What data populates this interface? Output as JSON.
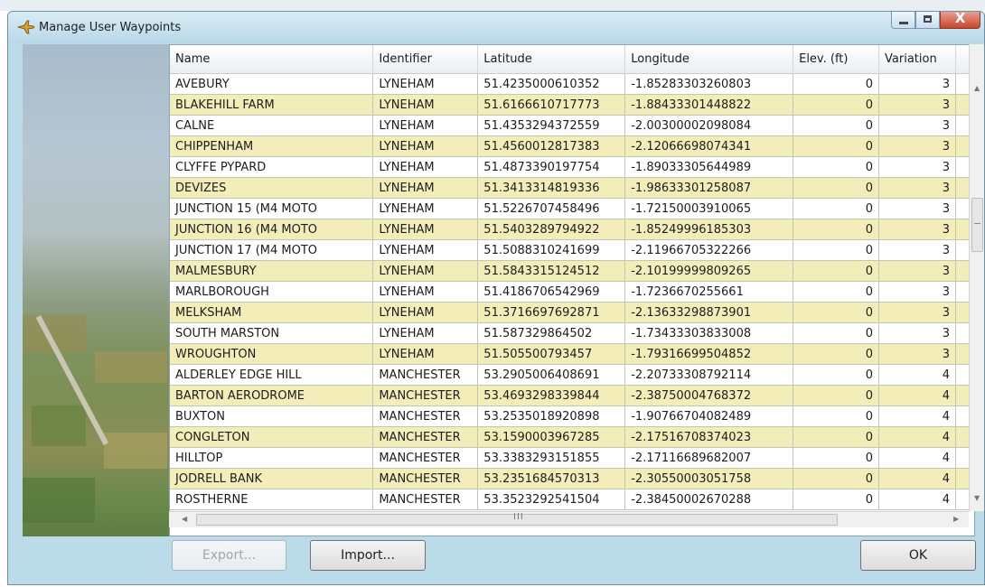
{
  "window": {
    "title": "Manage User Waypoints",
    "minimize_label": "",
    "maximize_label": "",
    "close_label": "X"
  },
  "table": {
    "columns": [
      "Name",
      "Identifier",
      "Latitude",
      "Longitude",
      "Elev. (ft)",
      "Variation"
    ],
    "rows": [
      [
        "AVEBURY",
        "LYNEHAM",
        "51.4235000610352",
        "-1.85283303260803",
        "0",
        "3"
      ],
      [
        "BLAKEHILL FARM",
        "LYNEHAM",
        "51.6166610717773",
        "-1.88433301448822",
        "0",
        "3"
      ],
      [
        "CALNE",
        "LYNEHAM",
        "51.4353294372559",
        "-2.00300002098084",
        "0",
        "3"
      ],
      [
        "CHIPPENHAM",
        "LYNEHAM",
        "51.4560012817383",
        "-2.12066698074341",
        "0",
        "3"
      ],
      [
        "CLYFFE PYPARD",
        "LYNEHAM",
        "51.4873390197754",
        "-1.89033305644989",
        "0",
        "3"
      ],
      [
        "DEVIZES",
        "LYNEHAM",
        "51.3413314819336",
        "-1.98633301258087",
        "0",
        "3"
      ],
      [
        "JUNCTION 15 (M4 MOTO",
        "LYNEHAM",
        "51.5226707458496",
        "-1.72150003910065",
        "0",
        "3"
      ],
      [
        "JUNCTION 16 (M4 MOTO",
        "LYNEHAM",
        "51.5403289794922",
        "-1.85249996185303",
        "0",
        "3"
      ],
      [
        "JUNCTION 17 (M4 MOTO",
        "LYNEHAM",
        "51.5088310241699",
        "-2.11966705322266",
        "0",
        "3"
      ],
      [
        "MALMESBURY",
        "LYNEHAM",
        "51.5843315124512",
        "-2.10199999809265",
        "0",
        "3"
      ],
      [
        "MARLBOROUGH",
        "LYNEHAM",
        "51.4186706542969",
        "-1.7236670255661",
        "0",
        "3"
      ],
      [
        "MELKSHAM",
        "LYNEHAM",
        "51.3716697692871",
        "-2.13633298873901",
        "0",
        "3"
      ],
      [
        "SOUTH MARSTON",
        "LYNEHAM",
        "51.587329864502",
        "-1.73433303833008",
        "0",
        "3"
      ],
      [
        "WROUGHTON",
        "LYNEHAM",
        "51.505500793457",
        "-1.79316699504852",
        "0",
        "3"
      ],
      [
        "ALDERLEY EDGE HILL",
        "MANCHESTER",
        "53.2905006408691",
        "-2.20733308792114",
        "0",
        "4"
      ],
      [
        "BARTON AERODROME",
        "MANCHESTER",
        "53.4693298339844",
        "-2.38750004768372",
        "0",
        "4"
      ],
      [
        "BUXTON",
        "MANCHESTER",
        "53.2535018920898",
        "-1.90766704082489",
        "0",
        "4"
      ],
      [
        "CONGLETON",
        "MANCHESTER",
        "53.1590003967285",
        "-2.17516708374023",
        "0",
        "4"
      ],
      [
        "HILLTOP",
        "MANCHESTER",
        "53.3383293151855",
        "-2.17116689682007",
        "0",
        "4"
      ],
      [
        "JODRELL BANK",
        "MANCHESTER",
        "53.2351684570313",
        "-2.30550003051758",
        "0",
        "4"
      ],
      [
        "ROSTHERNE",
        "MANCHESTER",
        "53.3523292541504",
        "-2.38450002670288",
        "0",
        "4"
      ]
    ]
  },
  "buttons": {
    "export_label": "Export...",
    "import_label": "Import...",
    "ok_label": "OK"
  },
  "scrollbar": {
    "grip_glyph": "III"
  },
  "icons": {
    "window": "airplane-icon",
    "scroll_up": "scroll-up-icon",
    "scroll_down": "scroll-down-icon",
    "scroll_left": "scroll-left-icon",
    "scroll_right": "scroll-right-icon"
  },
  "colors": {
    "row_alt": "#f3eeb9",
    "dialog_bg": "#bcdbe9",
    "close_button": "#c8462c"
  }
}
